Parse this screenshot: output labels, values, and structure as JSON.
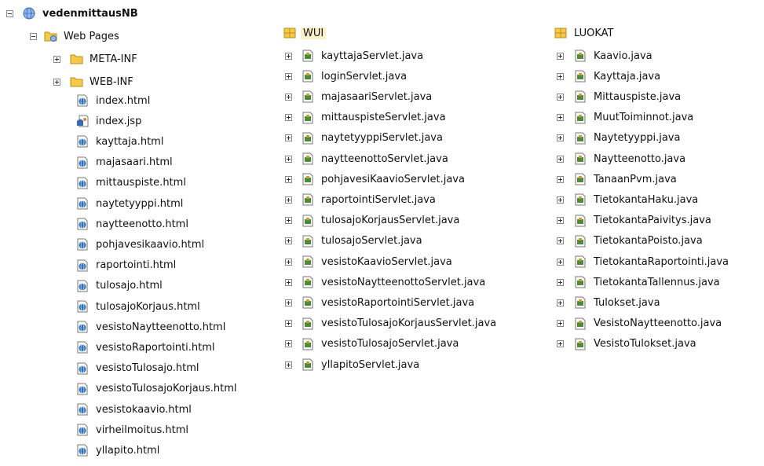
{
  "left": {
    "project": "vedenmittausNB",
    "web_pages": "Web Pages",
    "folders": [
      "META-INF",
      "WEB-INF"
    ],
    "files": [
      {
        "name": "index.html",
        "icon": "html-file-icon"
      },
      {
        "name": "index.jsp",
        "icon": "jsp-file-icon"
      },
      {
        "name": "kayttaja.html",
        "icon": "html-file-icon"
      },
      {
        "name": "majasaari.html",
        "icon": "html-file-icon"
      },
      {
        "name": "mittauspiste.html",
        "icon": "html-file-icon"
      },
      {
        "name": "naytetyyppi.html",
        "icon": "html-file-icon"
      },
      {
        "name": "naytteenotto.html",
        "icon": "html-file-icon"
      },
      {
        "name": "pohjavesikaavio.html",
        "icon": "html-file-icon"
      },
      {
        "name": "raportointi.html",
        "icon": "html-file-icon"
      },
      {
        "name": "tulosajo.html",
        "icon": "html-file-icon"
      },
      {
        "name": "tulosajoKorjaus.html",
        "icon": "html-file-icon"
      },
      {
        "name": "vesistoNaytteenotto.html",
        "icon": "html-file-icon"
      },
      {
        "name": "vesistoRaportointi.html",
        "icon": "html-file-icon"
      },
      {
        "name": "vesistoTulosajo.html",
        "icon": "html-file-icon"
      },
      {
        "name": "vesistoTulosajoKorjaus.html",
        "icon": "html-file-icon"
      },
      {
        "name": "vesistokaavio.html",
        "icon": "html-file-icon"
      },
      {
        "name": "virheilmoitus.html",
        "icon": "html-file-icon"
      },
      {
        "name": "yllapito.html",
        "icon": "html-file-icon"
      }
    ]
  },
  "middle": {
    "package": "WUI",
    "files": [
      "kayttajaServlet.java",
      "loginServlet.java",
      "majasaariServlet.java",
      "mittauspisteServlet.java",
      "naytetyyppiServlet.java",
      "naytteenottoServlet.java",
      "pohjavesiKaavioServlet.java",
      "raportointiServlet.java",
      "tulosajoKorjausServlet.java",
      "tulosajoServlet.java",
      "vesistoKaavioServlet.java",
      "vesistoNaytteenottoServlet.java",
      "vesistoRaportointiServlet.java",
      "vesistoTulosajoKorjausServlet.java",
      "vesistoTulosajoServlet.java",
      "yllapitoServlet.java"
    ]
  },
  "right": {
    "package": "LUOKAT",
    "files": [
      "Kaavio.java",
      "Kayttaja.java",
      "Mittauspiste.java",
      "MuutToiminnot.java",
      "Naytetyyppi.java",
      "Naytteenotto.java",
      "TanaanPvm.java",
      "TietokantaHaku.java",
      "TietokantaPaivitys.java",
      "TietokantaPoisto.java",
      "TietokantaRaportointi.java",
      "TietokantaTallennus.java",
      "Tulokset.java",
      "VesistoNaytteenotto.java",
      "VesistoTulokset.java"
    ]
  },
  "colors": {
    "folder": "#f5c949",
    "selection": "#fbf0c8",
    "html_blue": "#2e6fb8",
    "java_green": "#4d8a3a"
  }
}
